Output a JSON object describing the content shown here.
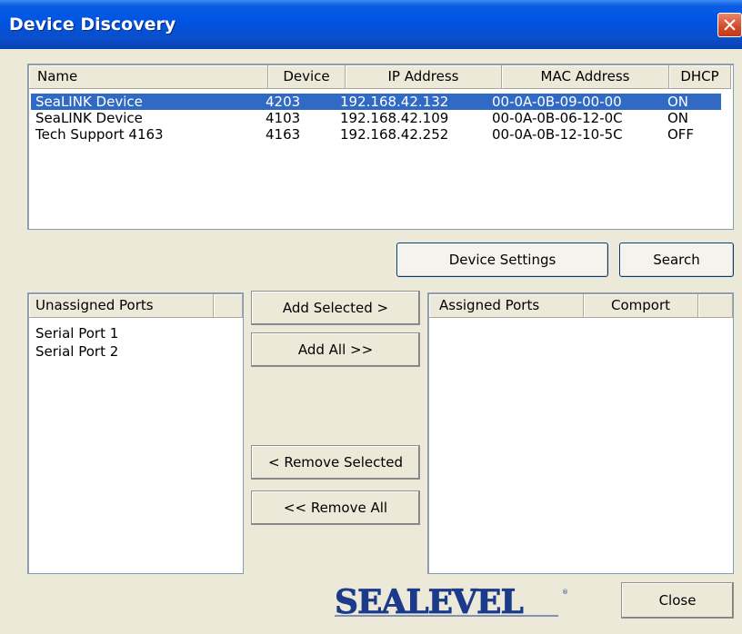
{
  "window": {
    "title": "Device Discovery"
  },
  "devices": {
    "columns": [
      "Name",
      "Device",
      "IP Address",
      "MAC Address",
      "DHCP"
    ],
    "rows": [
      {
        "name": "SeaLINK Device",
        "device": "4203",
        "ip": "192.168.42.132",
        "mac": "00-0A-0B-09-00-00",
        "dhcp": "ON",
        "selected": true
      },
      {
        "name": "SeaLINK Device",
        "device": "4103",
        "ip": "192.168.42.109",
        "mac": "00-0A-0B-06-12-0C",
        "dhcp": "ON",
        "selected": false
      },
      {
        "name": "Tech Support 4163",
        "device": "4163",
        "ip": "192.168.42.252",
        "mac": "00-0A-0B-12-10-5C",
        "dhcp": "OFF",
        "selected": false
      }
    ]
  },
  "buttons": {
    "device_settings": "Device Settings",
    "search": "Search",
    "add_selected": "Add Selected  >",
    "add_all": "Add All   >>",
    "remove_selected": "<  Remove Selected",
    "remove_all": "<<    Remove All",
    "close": "Close"
  },
  "unassigned": {
    "header": "Unassigned Ports",
    "items": [
      "Serial Port 1",
      "Serial Port 2"
    ]
  },
  "assigned": {
    "header": "Assigned Ports",
    "header2": "Comport",
    "items": []
  },
  "logo": {
    "text": "SEALEVEL",
    "color": "#1B3A8C"
  },
  "colors": {
    "selection": "#316AC5",
    "titlebar": "#0054E3",
    "face": "#ECE9D8"
  }
}
